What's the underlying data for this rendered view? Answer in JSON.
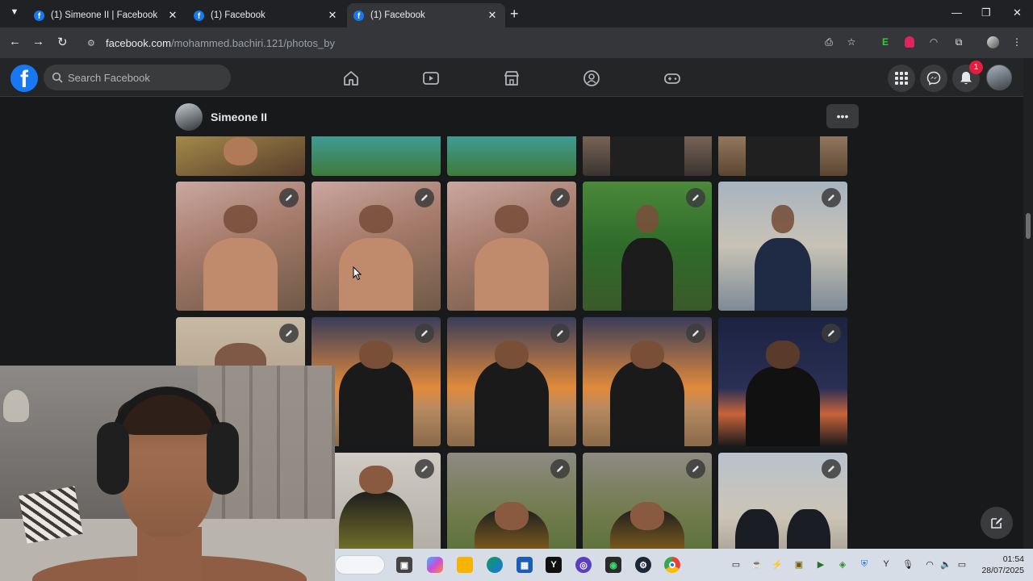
{
  "browser": {
    "tabs": [
      {
        "title": "(1) Simeone II | Facebook"
      },
      {
        "title": "(1) Facebook"
      },
      {
        "title": "(1) Facebook"
      }
    ],
    "url_host": "facebook.com",
    "url_path": "/mohammed.bachiri.121/photos_by",
    "extension_e_label": "E"
  },
  "facebook": {
    "search_placeholder": "Search Facebook",
    "notification_count": "1",
    "profile_name": "Simeone II",
    "more_label": "•••",
    "brand_color": "#1877f2"
  },
  "taskbar": {
    "time": "01:54",
    "date": "28/07/2025"
  }
}
